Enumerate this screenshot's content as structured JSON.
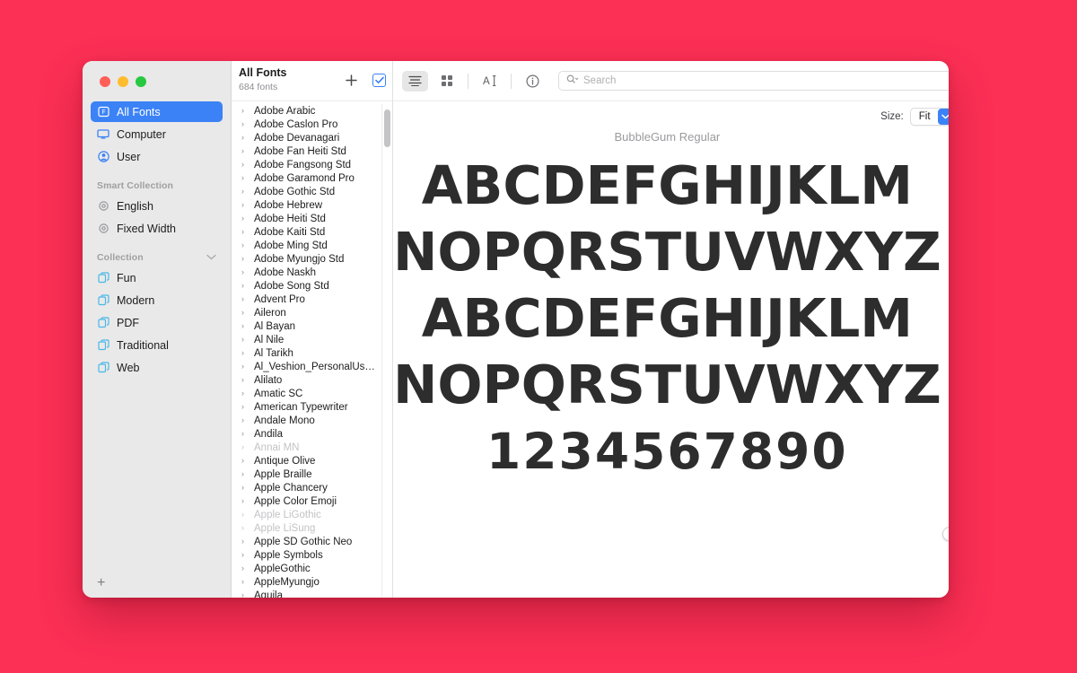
{
  "desktop": {
    "background_color": "#fc2f55"
  },
  "window": {
    "traffic_lights": [
      "close",
      "minimize",
      "zoom"
    ],
    "sidebar": {
      "items": [
        {
          "label": "All Fonts",
          "icon": "font-book-icon",
          "selected": true
        },
        {
          "label": "Computer",
          "icon": "computer-icon",
          "selected": false
        },
        {
          "label": "User",
          "icon": "user-icon",
          "selected": false
        }
      ],
      "smart_collection_header": "Smart Collection",
      "smart_collections": [
        {
          "label": "English",
          "icon": "gear-icon"
        },
        {
          "label": "Fixed Width",
          "icon": "gear-icon"
        }
      ],
      "collection_header": "Collection",
      "collections": [
        {
          "label": "Fun",
          "icon": "collection-icon"
        },
        {
          "label": "Modern",
          "icon": "collection-icon"
        },
        {
          "label": "PDF",
          "icon": "collection-icon"
        },
        {
          "label": "Traditional",
          "icon": "collection-icon"
        },
        {
          "label": "Web",
          "icon": "collection-icon"
        }
      ],
      "add_button_label": "+"
    },
    "list_panel": {
      "title": "All Fonts",
      "subtitle": "684 fonts",
      "add_button_label": "+",
      "checkbox_checked": true,
      "fonts": [
        {
          "name": "Adobe Arabic",
          "disabled": false
        },
        {
          "name": "Adobe Caslon Pro",
          "disabled": false
        },
        {
          "name": "Adobe Devanagari",
          "disabled": false
        },
        {
          "name": "Adobe Fan Heiti Std",
          "disabled": false
        },
        {
          "name": "Adobe Fangsong Std",
          "disabled": false
        },
        {
          "name": "Adobe Garamond Pro",
          "disabled": false
        },
        {
          "name": "Adobe Gothic Std",
          "disabled": false
        },
        {
          "name": "Adobe Hebrew",
          "disabled": false
        },
        {
          "name": "Adobe Heiti Std",
          "disabled": false
        },
        {
          "name": "Adobe Kaiti Std",
          "disabled": false
        },
        {
          "name": "Adobe Ming Std",
          "disabled": false
        },
        {
          "name": "Adobe Myungjo Std",
          "disabled": false
        },
        {
          "name": "Adobe Naskh",
          "disabled": false
        },
        {
          "name": "Adobe Song Std",
          "disabled": false
        },
        {
          "name": "Advent Pro",
          "disabled": false
        },
        {
          "name": "Aileron",
          "disabled": false
        },
        {
          "name": "Al Bayan",
          "disabled": false
        },
        {
          "name": "Al Nile",
          "disabled": false
        },
        {
          "name": "Al Tarikh",
          "disabled": false
        },
        {
          "name": "Al_Veshion_PersonalUs…",
          "disabled": false
        },
        {
          "name": "Alilato",
          "disabled": false
        },
        {
          "name": "Amatic SC",
          "disabled": false
        },
        {
          "name": "American Typewriter",
          "disabled": false
        },
        {
          "name": "Andale Mono",
          "disabled": false
        },
        {
          "name": "Andila",
          "disabled": false
        },
        {
          "name": "Annai MN",
          "disabled": true
        },
        {
          "name": "Antique Olive",
          "disabled": false
        },
        {
          "name": "Apple Braille",
          "disabled": false
        },
        {
          "name": "Apple Chancery",
          "disabled": false
        },
        {
          "name": "Apple Color Emoji",
          "disabled": false
        },
        {
          "name": "Apple LiGothic",
          "disabled": true
        },
        {
          "name": "Apple LiSung",
          "disabled": true
        },
        {
          "name": "Apple SD Gothic Neo",
          "disabled": false
        },
        {
          "name": "Apple Symbols",
          "disabled": false
        },
        {
          "name": "AppleGothic",
          "disabled": false
        },
        {
          "name": "AppleMyungjo",
          "disabled": false
        },
        {
          "name": "Aquila",
          "disabled": false
        }
      ]
    },
    "toolbar": {
      "buttons": [
        {
          "name": "sample-view-button",
          "icon": "lines-icon",
          "selected": true
        },
        {
          "name": "repertoire-view-button",
          "icon": "grid-icon",
          "selected": false
        },
        {
          "name": "custom-text-button",
          "icon": "text-cursor-icon",
          "selected": false
        },
        {
          "name": "info-button",
          "icon": "info-circle-icon",
          "selected": false
        }
      ],
      "search": {
        "placeholder": "Search",
        "value": "",
        "icon": "search-icon"
      }
    },
    "size_control": {
      "label": "Size:",
      "value": "Fit",
      "chevron": "chevron-down-icon"
    },
    "preview": {
      "font_title": "BubbleGum Regular",
      "sample_lines": [
        "ABCDEFGHIJKLM",
        "NOPQRSTUVWXYZ",
        "ABCDEFGHIJKLM",
        "NOPQRSTUVWXYZ",
        "1234567890"
      ]
    }
  }
}
